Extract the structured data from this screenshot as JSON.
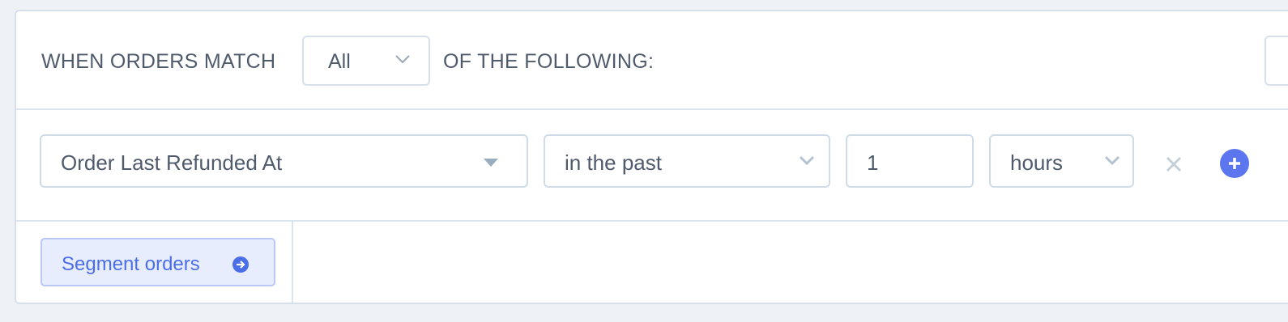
{
  "filter": {
    "prefix_text": "WHEN ORDERS MATCH",
    "match_select": {
      "value": "All"
    },
    "suffix_text": "OF THE FOLLOWING:"
  },
  "condition": {
    "field": "Order Last Refunded At",
    "operator": "in the past",
    "amount": "1",
    "unit": "hours"
  },
  "actions": {
    "segment_label": "Segment orders"
  },
  "icons": {
    "match_chevron": "chevron-down-icon",
    "field_caret": "caret-down-icon",
    "operator_chevron": "chevron-down-icon",
    "unit_chevron": "chevron-down-icon",
    "remove": "close-icon",
    "add": "plus-circle-icon",
    "segment": "arrow-right-circle-icon"
  },
  "colors": {
    "accent": "#5b76ee",
    "link": "#4a6ee8",
    "text": "#4f5b6d",
    "border": "#d6e0ea",
    "background": "#eef2f7"
  }
}
